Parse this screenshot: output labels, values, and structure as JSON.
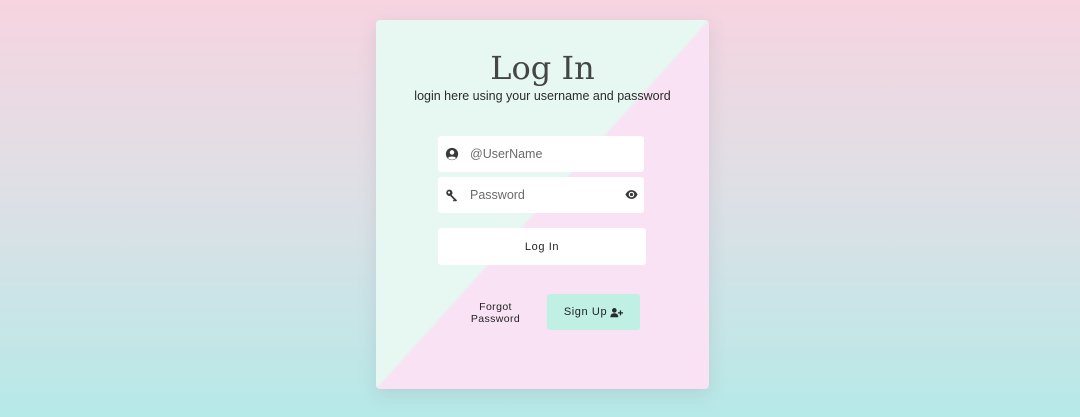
{
  "card": {
    "title": "Log In",
    "subtitle": "login here using your username and password"
  },
  "username_field": {
    "placeholder": "@UserName",
    "value": "",
    "icon": "user-circle-icon"
  },
  "password_field": {
    "placeholder": "Password",
    "value": "",
    "icon": "key-icon",
    "toggle_icon": "eye-icon"
  },
  "buttons": {
    "login_label": "Log In",
    "forgot_line1": "Forgot",
    "forgot_line2": "Password",
    "signup_label": "Sign Up",
    "signup_icon": "user-plus-icon"
  },
  "colors": {
    "background_top": "#f6d4e0",
    "background_bottom": "#b6e9e8",
    "card_mint": "#e6f8f1",
    "card_pink": "#f8e2f4",
    "signup_button": "#bff0e3",
    "title_text": "#454545"
  }
}
